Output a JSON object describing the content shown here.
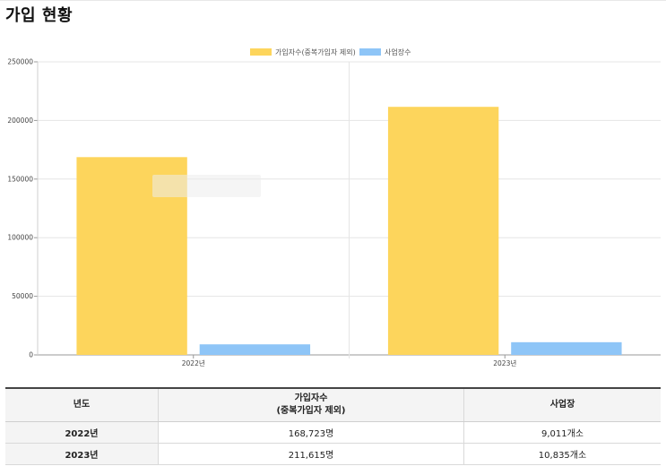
{
  "page": {
    "title": "가입 현황"
  },
  "chart_data": {
    "type": "bar",
    "categories": [
      "2022년",
      "2023년"
    ],
    "series": [
      {
        "name": "가입자수(중복가입자 제외)",
        "color": "#FDD55C",
        "values": [
          168723,
          211615
        ]
      },
      {
        "name": "사업장수",
        "color": "#8EC5F7",
        "values": [
          9011,
          10835
        ]
      }
    ],
    "ylim": [
      0,
      250000
    ],
    "yticks": [
      "0",
      "50000",
      "100000",
      "150000",
      "200000",
      "250000"
    ],
    "yticks_values": [
      0,
      50000,
      100000,
      150000,
      200000,
      250000
    ],
    "grid": true,
    "legend": "top-center"
  },
  "table": {
    "headers": {
      "year": "년도",
      "members_line1": "가입자수",
      "members_line2": "(중복가입자 제외)",
      "workplaces": "사업장"
    },
    "rows": [
      {
        "year": "2022년",
        "members": "168,723명",
        "workplaces": "9,011개소"
      },
      {
        "year": "2023년",
        "members": "211,615명",
        "workplaces": "10,835개소"
      }
    ]
  }
}
